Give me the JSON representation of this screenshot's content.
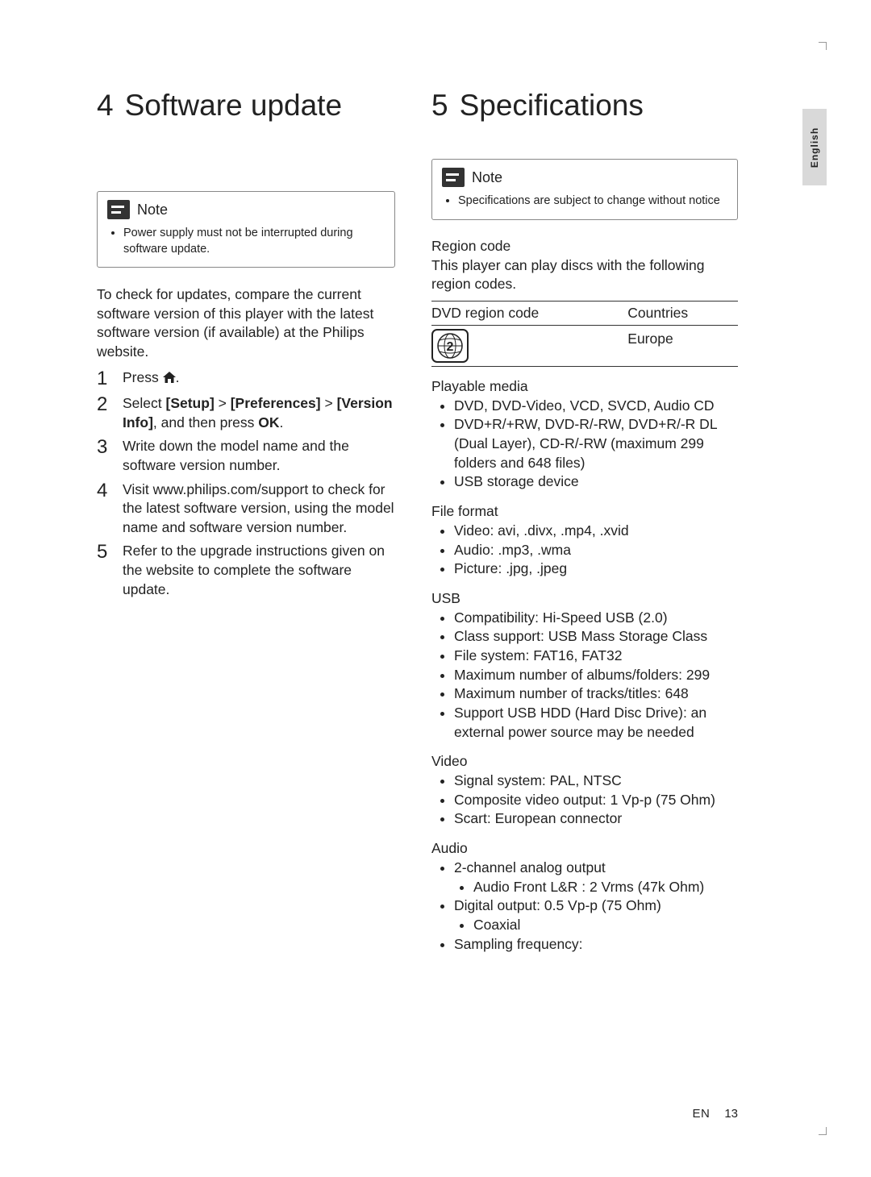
{
  "sideTab": "English",
  "left": {
    "sectionNumber": "4",
    "sectionTitle": "Software update",
    "note": {
      "label": "Note",
      "items": [
        "Power supply must not be interrupted during software update."
      ]
    },
    "intro": "To check for updates, compare the current software version of this player with the latest software version (if available) at the Philips website.",
    "steps": [
      {
        "num": "1",
        "pre": "Press ",
        "icon": "home",
        "post": "."
      },
      {
        "num": "2",
        "pre": "Select ",
        "bold1": "[Setup]",
        "mid1": " > ",
        "bold2": "[Preferences]",
        "mid2": " > ",
        "bold3": "[Version Info]",
        "post": ", and then press ",
        "bold4": "OK",
        "end": "."
      },
      {
        "num": "3",
        "text": "Write down the model name and the software version number."
      },
      {
        "num": "4",
        "text": "Visit www.philips.com/support to check for the latest software version, using the model name and software version number."
      },
      {
        "num": "5",
        "text": "Refer to the upgrade instructions given on the website to complete the software update."
      }
    ]
  },
  "right": {
    "sectionNumber": "5",
    "sectionTitle": "Specifications",
    "note": {
      "label": "Note",
      "items": [
        "Specifications are subject to change without notice"
      ]
    },
    "region": {
      "heading": "Region code",
      "text": "This player can play discs with the following region codes.",
      "tableHeaders": [
        "DVD region code",
        "Countries"
      ],
      "row": {
        "iconNumber": "2",
        "country": "Europe"
      }
    },
    "playable": {
      "heading": "Playable media",
      "items": [
        "DVD, DVD-Video, VCD, SVCD, Audio CD",
        "DVD+R/+RW, DVD-R/-RW, DVD+R/-R DL (Dual Layer), CD-R/-RW (maximum 299 folders and 648 files)",
        "USB storage device"
      ]
    },
    "fileformat": {
      "heading": "File format",
      "items": [
        "Video: avi, .divx, .mp4, .xvid",
        "Audio: .mp3, .wma",
        "Picture: .jpg, .jpeg"
      ]
    },
    "usb": {
      "heading": "USB",
      "items": [
        "Compatibility: Hi-Speed USB (2.0)",
        "Class support: USB Mass Storage Class",
        "File system: FAT16, FAT32",
        "Maximum number of albums/folders: 299",
        "Maximum number of tracks/titles: 648",
        "Support USB HDD (Hard Disc Drive): an external power source may be needed"
      ]
    },
    "video": {
      "heading": "Video",
      "items": [
        "Signal system: PAL, NTSC",
        "Composite video output: 1 Vp-p (75 Ohm)",
        "Scart: European connector"
      ]
    },
    "audio": {
      "heading": "Audio",
      "items": [
        {
          "text": "2-channel analog output",
          "sub": [
            "Audio Front L&R : 2 Vrms (47k Ohm)"
          ]
        },
        {
          "text": "Digital output: 0.5 Vp-p (75 Ohm)",
          "sub": [
            "Coaxial"
          ]
        },
        {
          "text": "Sampling frequency:"
        }
      ]
    }
  },
  "footer": {
    "lang": "EN",
    "page": "13"
  }
}
